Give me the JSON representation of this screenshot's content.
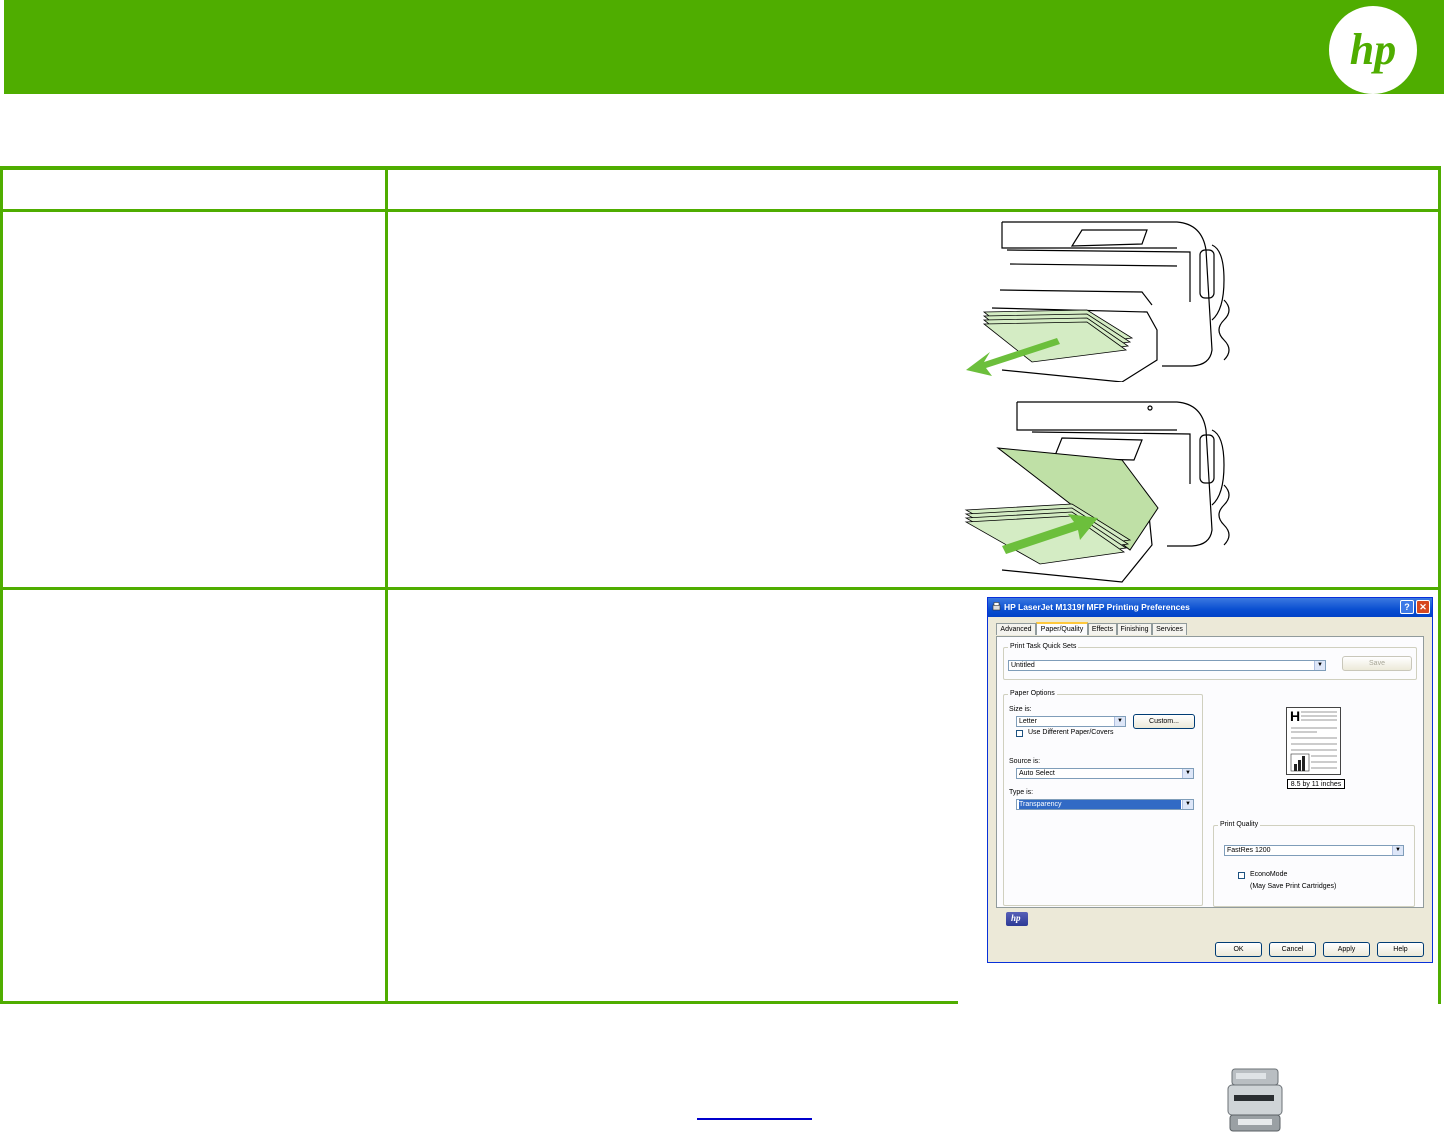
{
  "brand": {
    "logo_icon": "hp-logo",
    "header_color": "#4fad00"
  },
  "dialog": {
    "title": "HP LaserJet M1319f MFP Printing Preferences",
    "tabs": [
      {
        "label": "Advanced"
      },
      {
        "label": "Paper/Quality",
        "active": true
      },
      {
        "label": "Effects"
      },
      {
        "label": "Finishing"
      },
      {
        "label": "Services"
      }
    ],
    "quick_sets": {
      "group_title": "Print Task Quick Sets",
      "value": "Untitled",
      "save_label": "Save"
    },
    "paper_options": {
      "group_title": "Paper Options",
      "size_label": "Size is:",
      "size_value": "Letter",
      "custom_label": "Custom...",
      "different_paper_label": "Use Different Paper/Covers",
      "source_label": "Source is:",
      "source_value": "Auto Select",
      "type_label": "Type is:",
      "type_value": "Transparency"
    },
    "preview": {
      "page_letter": "H",
      "caption": "8.5 by 11 inches"
    },
    "print_quality": {
      "group_title": "Print Quality",
      "value": "FastRes 1200",
      "econo_label": "EconoMode",
      "econo_note": "(May Save Print Cartridges)"
    },
    "buttons": {
      "ok": "OK",
      "cancel": "Cancel",
      "apply": "Apply",
      "help": "Help"
    },
    "help_glyph": "?",
    "close_glyph": "✕"
  }
}
